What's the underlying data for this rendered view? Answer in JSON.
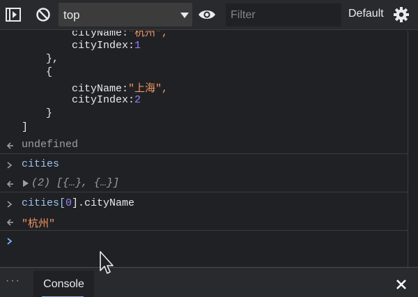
{
  "toolbar": {
    "context_value": "top",
    "filter_placeholder": "Filter",
    "filter_value": "",
    "levels_label": "Default",
    "icons": [
      "sidebar-toggle-icon",
      "clear-console-icon",
      "dropdown-arrow-icon",
      "eye-icon",
      "gear-icon"
    ]
  },
  "console": {
    "lines": {
      "l1_key": "cityName:",
      "l1_str": "\"杭州\",",
      "l2_key": "cityIndex:",
      "l2_num": "1",
      "l3": "},",
      "l4": "{",
      "l5_key": "cityName:",
      "l5_str": "\"上海\",",
      "l6_key": "cityIndex:",
      "l6_num": "2",
      "l7": "}",
      "l8": "]"
    },
    "result1": "undefined",
    "input1": "cities",
    "result2_prefix": "(2) ",
    "result2_body": "[{…}, {…}]",
    "input2_a": "cities[",
    "input2_idx": "0",
    "input2_b": "].cityName",
    "result3": "\"杭州\"",
    "colors": {
      "string": "#f29766",
      "number": "#9980ff",
      "input": "#9fc2f0",
      "prompt": "#7cacf8"
    }
  },
  "drawer": {
    "more_label": "⋮",
    "tab_console": "Console"
  }
}
